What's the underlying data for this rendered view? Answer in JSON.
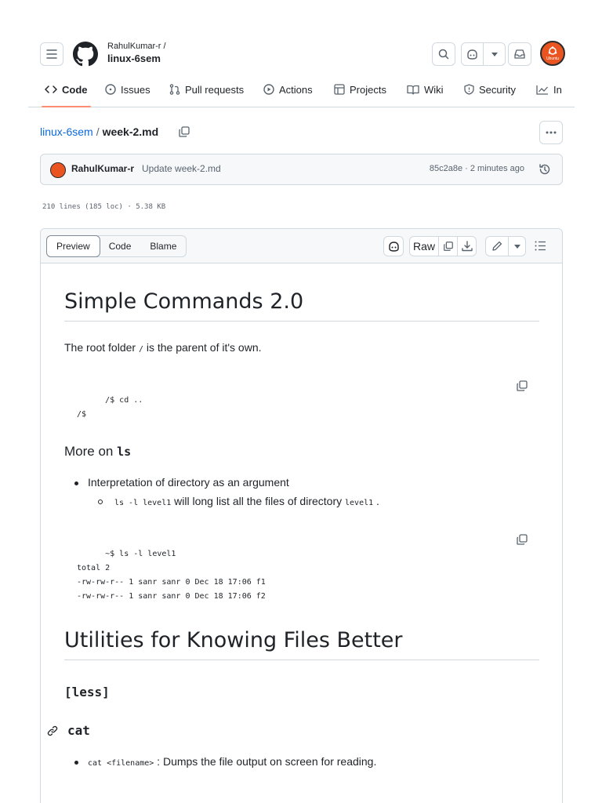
{
  "header": {
    "owner": "RahulKumar-r /",
    "repo": "linux-6sem",
    "avatar_text": "Ubuntu"
  },
  "nav": {
    "items": [
      {
        "label": "Code",
        "icon": "code-icon"
      },
      {
        "label": "Issues",
        "icon": "issue-icon"
      },
      {
        "label": "Pull requests",
        "icon": "pull-request-icon"
      },
      {
        "label": "Actions",
        "icon": "play-icon"
      },
      {
        "label": "Projects",
        "icon": "table-icon"
      },
      {
        "label": "Wiki",
        "icon": "book-icon"
      },
      {
        "label": "Security",
        "icon": "shield-icon"
      },
      {
        "label": "In",
        "icon": "graph-icon"
      }
    ]
  },
  "breadcrumb": {
    "repo": "linux-6sem",
    "separator": "/",
    "file": "week-2.md"
  },
  "commit": {
    "author": "RahulKumar-r",
    "message": "Update week-2.md",
    "meta": "85c2a8e · 2 minutes ago"
  },
  "file_info": "210 lines (185 loc) · 5.38 KB",
  "toolbar": {
    "tabs": [
      "Preview",
      "Code",
      "Blame"
    ],
    "raw": "Raw"
  },
  "markdown": {
    "h1_simple": "Simple Commands 2.0",
    "root_p_before": "The root folder ",
    "root_p_code": "/",
    "root_p_after": " is the parent of it's own.",
    "code1": "/$ cd ..\n/$",
    "h3_more": "More on ",
    "h3_more_code": "ls",
    "bullet_interp": "Interpretation of directory as an argument",
    "sub_code": "ls -l level1",
    "sub_text": " will long list all the files of directory ",
    "sub_code2": "level1",
    "sub_end": " .",
    "code2": "~$ ls -l level1\ntotal 2\n-rw-rw-r-- 1 sanr sanr 0 Dec 18 17:06 f1\n-rw-rw-r-- 1 sanr sanr 0 Dec 18 17:06 f2",
    "h1_utilities": "Utilities for Knowing Files Better",
    "h3_less": "[less]",
    "h3_cat": "cat",
    "bullet_cat_code": "cat <filename>",
    "bullet_cat_text": " : Dumps the file output on screen for reading."
  }
}
